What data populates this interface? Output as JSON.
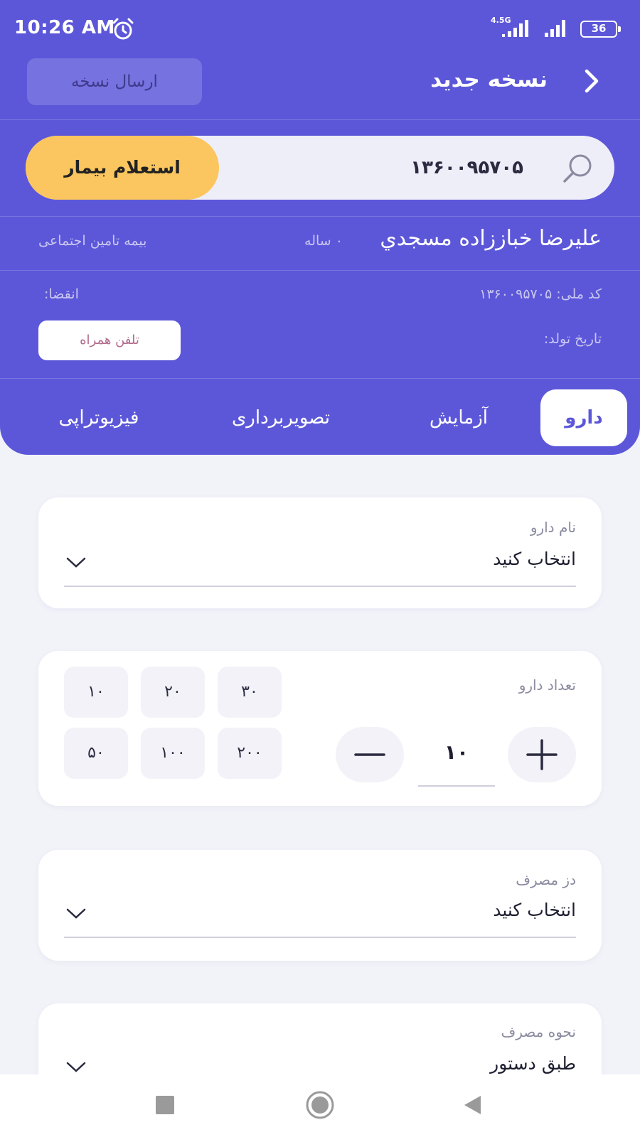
{
  "status_bar": {
    "time": "10:26 AM",
    "network": "4.5G",
    "battery": "36"
  },
  "topbar": {
    "title": "نسخه جدید",
    "send_label": "ارسال نسخه"
  },
  "search": {
    "value": "۱۳۶۰۰۹۵۷۰۵",
    "button_label": "استعلام بیمار"
  },
  "patient": {
    "name": "عليرضا خباززاده مسجدي",
    "age": "۰ ساله",
    "insurance": "بیمه تامین اجتماعی",
    "national_code": "کد ملی: ۱۳۶۰۰۹۵۷۰۵",
    "expiry": "انقضا:",
    "birth_date": "تاریخ تولد:",
    "phone_label": "تلفن همراه"
  },
  "tabs": [
    {
      "label": "دارو",
      "active": true
    },
    {
      "label": "آزمایش",
      "active": false
    },
    {
      "label": "تصویربرداری",
      "active": false
    },
    {
      "label": "فیزیوتراپی",
      "active": false
    }
  ],
  "drug_name": {
    "label": "نام دارو",
    "value": "انتخاب کنید"
  },
  "quantity": {
    "label": "تعداد دارو",
    "value": "۱۰",
    "presets": [
      "۱۰",
      "۲۰",
      "۳۰",
      "۵۰",
      "۱۰۰",
      "۲۰۰"
    ]
  },
  "dose": {
    "label": "دز مصرف",
    "value": "انتخاب کنید"
  },
  "usage": {
    "label": "نحوه مصرف",
    "value": "طبق دستور"
  },
  "colors": {
    "primary": "#5C57D9",
    "accent": "#FBC65F",
    "background": "#F2F2F9"
  }
}
